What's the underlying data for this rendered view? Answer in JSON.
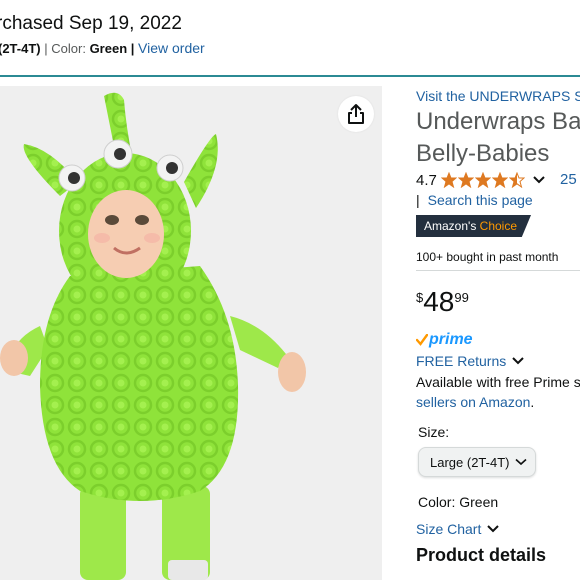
{
  "order": {
    "purchased": "rchased Sep 19, 2022",
    "size_fragment": "(2T-4T)",
    "color_label": "Color:",
    "color_value": "Green",
    "view_order": "View order"
  },
  "product": {
    "brand_link": "Visit the UNDERWRAPS St",
    "title_line1": "Underwraps Ba",
    "title_line2": "Belly-Babies",
    "rating": "4.7",
    "stars_filled": 4.5,
    "review_count": "25",
    "search_link": "Search this page",
    "badge_prefix": "Amazon's",
    "badge_suffix": "Choice",
    "bought": "100+ bought in past month",
    "price_symbol": "$",
    "price_whole": "48",
    "price_fraction": "99",
    "prime_label": "prime",
    "free_returns": "FREE Returns",
    "availability": "Available with free Prime s",
    "sellers_link": "sellers on Amazon",
    "sellers_period": ".",
    "size_label": "Size:",
    "size_selected": "Large (2T-4T)",
    "color_label": "Color:",
    "color_value": "Green",
    "size_chart": "Size Chart",
    "details_heading": "Product details"
  },
  "colors": {
    "link": "#2162a1",
    "star": "#de7921",
    "prime": "#1a98ff",
    "badge_bg": "#232f3e",
    "badge_accent": "#ff9900",
    "divider": "#2b8a94",
    "costume_green": "#8fe33a"
  },
  "icons": {
    "share": "share-icon",
    "chevron": "chevron-down-icon",
    "check": "prime-check-icon"
  }
}
